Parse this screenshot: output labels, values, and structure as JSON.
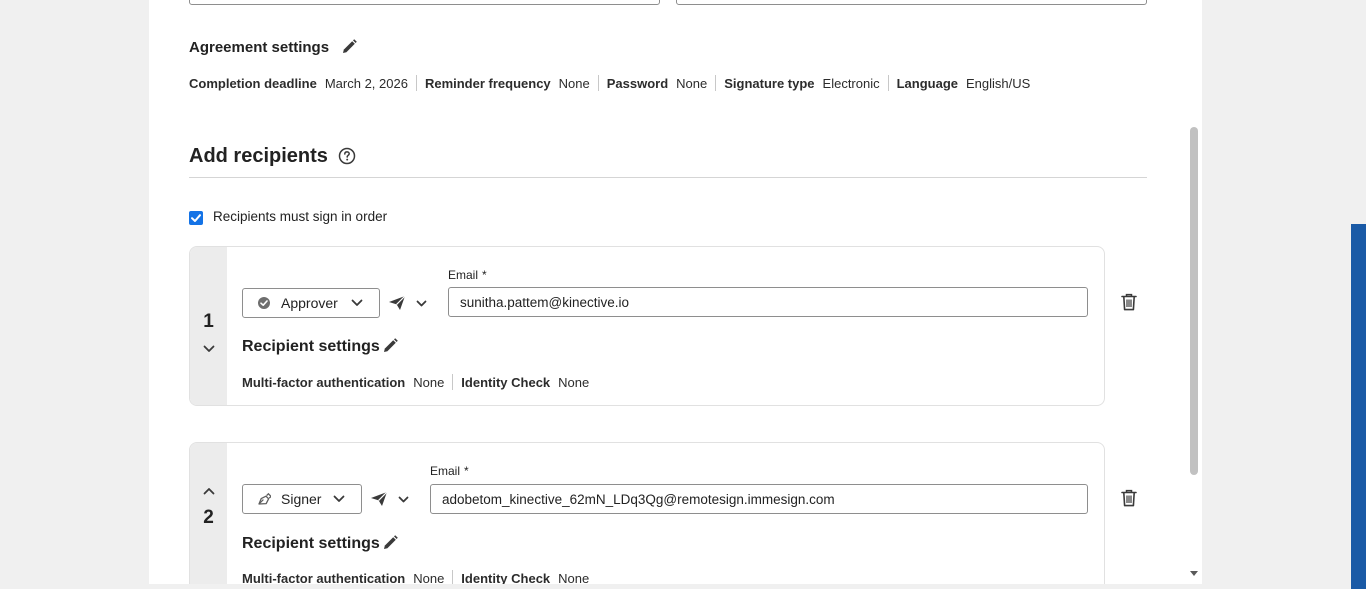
{
  "agreement_settings": {
    "title": "Agreement settings",
    "items": [
      {
        "label": "Completion deadline",
        "value": "March 2, 2026"
      },
      {
        "label": "Reminder frequency",
        "value": "None"
      },
      {
        "label": "Password",
        "value": "None"
      },
      {
        "label": "Signature type",
        "value": "Electronic"
      },
      {
        "label": "Language",
        "value": "English/US"
      }
    ]
  },
  "recipients": {
    "title": "Add recipients",
    "sign_in_order_label": "Recipients must sign in order",
    "sign_in_order_checked": true,
    "list": [
      {
        "number": "1",
        "role": "Approver",
        "email_label": "Email",
        "required_mark": "*",
        "email": "sunitha.pattem@kinective.io",
        "settings_title": "Recipient settings",
        "settings": [
          {
            "label": "Multi-factor authentication",
            "value": "None"
          },
          {
            "label": "Identity Check",
            "value": "None"
          }
        ]
      },
      {
        "number": "2",
        "role": "Signer",
        "email_label": "Email",
        "required_mark": "*",
        "email": "adobetom_kinective_62mN_LDq3Qg@remotesign.immesign.com",
        "settings_title": "Recipient settings",
        "settings": [
          {
            "label": "Multi-factor authentication",
            "value": "None"
          },
          {
            "label": "Identity Check",
            "value": "None"
          }
        ]
      }
    ]
  },
  "icons": {
    "edit": "pencil-icon",
    "help": "help-circle-icon",
    "approver": "check-circle-icon",
    "signer": "pen-nib-icon",
    "send": "paper-plane-icon",
    "delete": "trash-icon"
  },
  "colors": {
    "accent": "#1473e6",
    "side_strip": "#1a5aa6"
  }
}
